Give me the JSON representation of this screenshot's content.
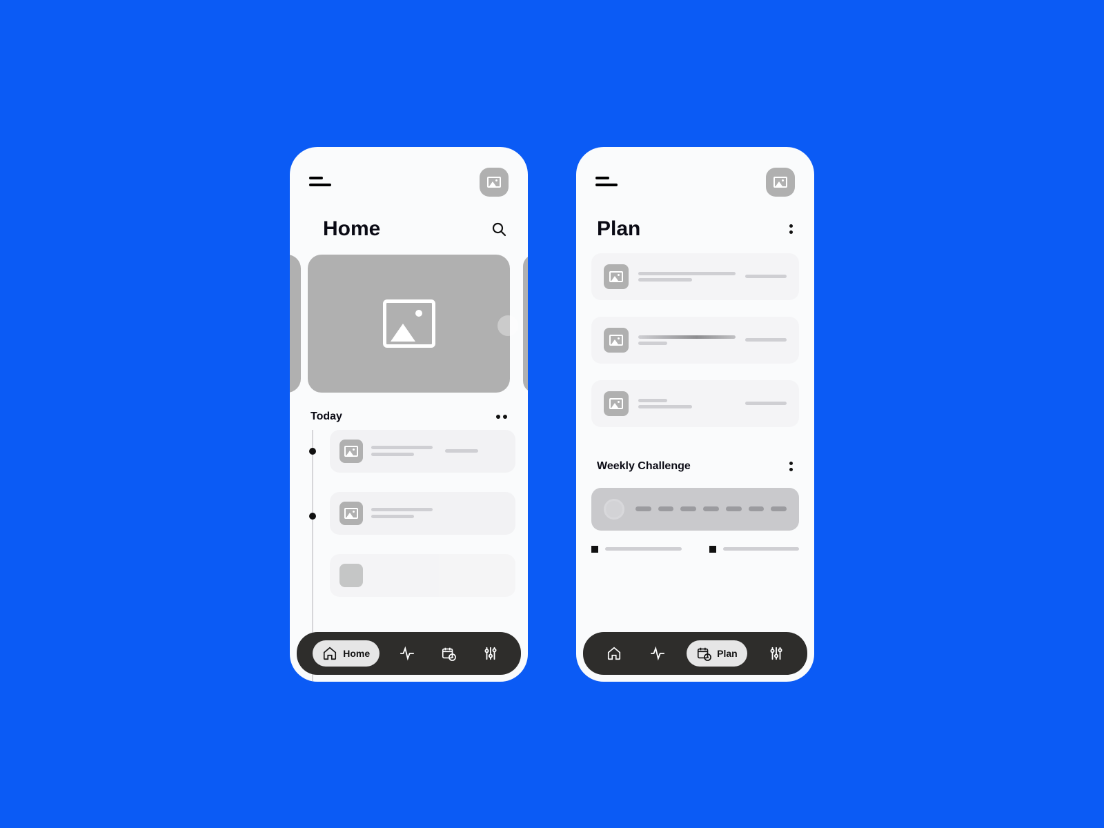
{
  "screens": {
    "home": {
      "title": "Home",
      "today_label": "Today",
      "nav": {
        "home": "Home"
      }
    },
    "plan": {
      "title": "Plan",
      "weekly_label": "Weekly Challenge",
      "nav": {
        "plan": "Plan"
      }
    }
  }
}
